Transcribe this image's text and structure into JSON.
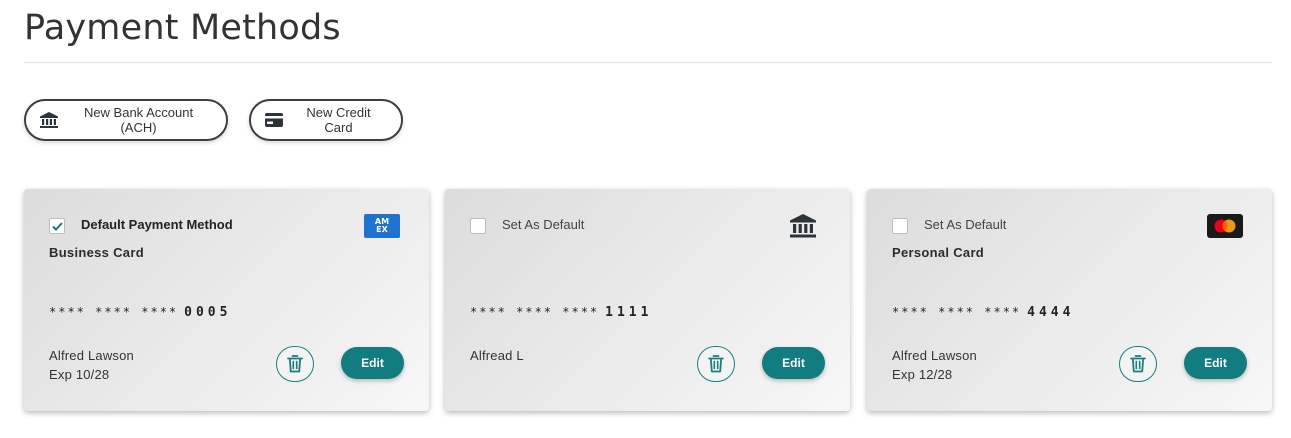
{
  "page": {
    "title": "Payment Methods"
  },
  "actions": {
    "new_bank": "New Bank Account (ACH)",
    "new_card": "New Credit Card"
  },
  "cards": [
    {
      "default_label": "Default Payment Method",
      "is_default": true,
      "nickname": "Business Card",
      "masked": "**** **** ****",
      "last4": "0005",
      "holder": "Alfred Lawson",
      "expiry": "Exp 10/28",
      "brand": "amex",
      "brand_text_1": "AM",
      "brand_text_2": "EX",
      "edit_label": "Edit"
    },
    {
      "default_label": "Set As Default",
      "is_default": false,
      "nickname": "",
      "masked": "**** **** ****",
      "last4": "1111",
      "holder": "Alfread L",
      "expiry": "",
      "brand": "bank",
      "edit_label": "Edit"
    },
    {
      "default_label": "Set As Default",
      "is_default": false,
      "nickname": "Personal Card",
      "masked": "**** **** ****",
      "last4": "4444",
      "holder": "Alfred Lawson",
      "expiry": "Exp 12/28",
      "brand": "mastercard",
      "edit_label": "Edit"
    }
  ],
  "colors": {
    "accent": "#117d80",
    "amex": "#1f72cd",
    "mastercard_red": "#eb001b",
    "mastercard_orange": "#f79e1b"
  }
}
